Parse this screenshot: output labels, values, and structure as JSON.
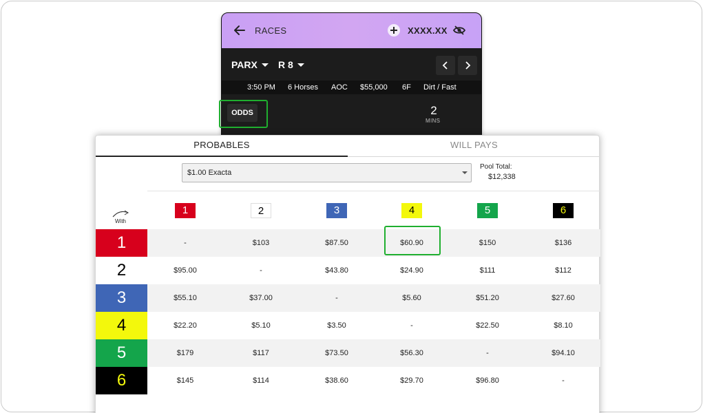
{
  "phone": {
    "title": "RACES",
    "balance": "XXXX.XX",
    "track": "PARX",
    "race": "R 8",
    "info": [
      "3:50 PM",
      "6 Horses",
      "AOC",
      "$55,000",
      "6F",
      "Dirt / Fast"
    ],
    "odds_label": "ODDS",
    "mins_value": "2",
    "mins_label": "MINS"
  },
  "tabs": {
    "probables": "PROBABLES",
    "will_pays": "WILL PAYS"
  },
  "bet_select": {
    "value": "$1.00 Exacta"
  },
  "pool": {
    "label": "Pool Total:",
    "value": "$12,338"
  },
  "with_label": "With",
  "runners": [
    {
      "num": "1",
      "bg": "#d7001c",
      "fg": "#ffffff"
    },
    {
      "num": "2",
      "bg": "#ffffff",
      "fg": "#000000"
    },
    {
      "num": "3",
      "bg": "#3f66b6",
      "fg": "#ffffff"
    },
    {
      "num": "4",
      "bg": "#f3f80c",
      "fg": "#000000"
    },
    {
      "num": "5",
      "bg": "#14a54b",
      "fg": "#ffffff"
    },
    {
      "num": "6",
      "bg": "#000000",
      "fg": "#f3f80c"
    }
  ],
  "grid": [
    [
      "-",
      "$103",
      "$87.50",
      "$60.90",
      "$150",
      "$136"
    ],
    [
      "$95.00",
      "-",
      "$43.80",
      "$24.90",
      "$111",
      "$112"
    ],
    [
      "$55.10",
      "$37.00",
      "-",
      "$5.60",
      "$51.20",
      "$27.60"
    ],
    [
      "$22.20",
      "$5.10",
      "$3.50",
      "-",
      "$22.50",
      "$8.10"
    ],
    [
      "$179",
      "$117",
      "$73.50",
      "$56.30",
      "-",
      "$94.10"
    ],
    [
      "$145",
      "$114",
      "$38.60",
      "$29.70",
      "$96.80",
      "-"
    ]
  ]
}
